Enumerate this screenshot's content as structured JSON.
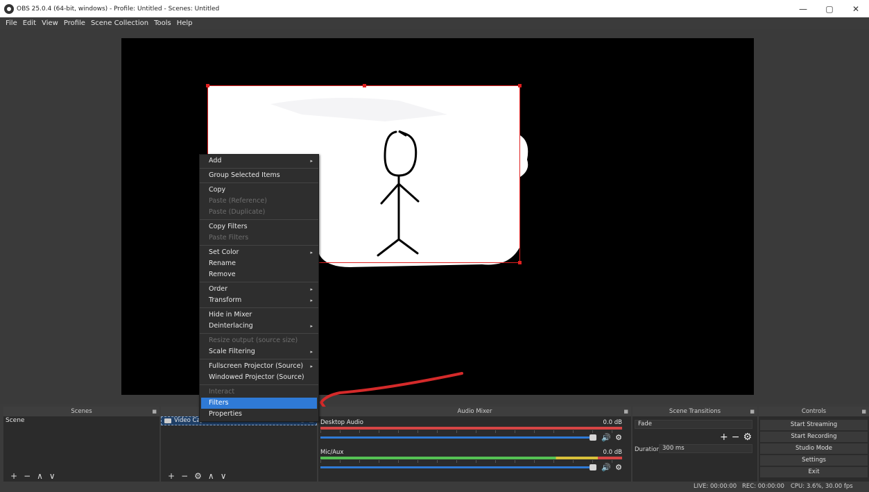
{
  "window": {
    "title": "OBS 25.0.4 (64-bit, windows) - Profile: Untitled - Scenes: Untitled",
    "minimize": "—",
    "maximize": "▢",
    "close": "✕"
  },
  "menubar": [
    "File",
    "Edit",
    "View",
    "Profile",
    "Scene Collection",
    "Tools",
    "Help"
  ],
  "context_menu": {
    "items": [
      {
        "label": "Add",
        "submenu": true
      },
      {
        "separator": true
      },
      {
        "label": "Group Selected Items"
      },
      {
        "separator": true
      },
      {
        "label": "Copy"
      },
      {
        "label": "Paste (Reference)",
        "disabled": true
      },
      {
        "label": "Paste (Duplicate)",
        "disabled": true
      },
      {
        "separator": true
      },
      {
        "label": "Copy Filters"
      },
      {
        "label": "Paste Filters",
        "disabled": true
      },
      {
        "separator": true
      },
      {
        "label": "Set Color",
        "submenu": true
      },
      {
        "label": "Rename"
      },
      {
        "label": "Remove"
      },
      {
        "separator": true
      },
      {
        "label": "Order",
        "submenu": true
      },
      {
        "label": "Transform",
        "submenu": true
      },
      {
        "separator": true
      },
      {
        "label": "Hide in Mixer"
      },
      {
        "label": "Deinterlacing",
        "submenu": true
      },
      {
        "separator": true
      },
      {
        "label": "Resize output (source size)",
        "disabled": true
      },
      {
        "label": "Scale Filtering",
        "submenu": true
      },
      {
        "separator": true
      },
      {
        "label": "Fullscreen Projector (Source)",
        "submenu": true
      },
      {
        "label": "Windowed Projector (Source)"
      },
      {
        "separator": true
      },
      {
        "label": "Interact",
        "disabled": true
      },
      {
        "label": "Filters",
        "highlighted": true
      },
      {
        "label": "Properties"
      }
    ]
  },
  "docks": {
    "scenes": {
      "title": "Scenes",
      "items": [
        "Scene"
      ]
    },
    "sources": {
      "items": [
        "Video Capture Device"
      ]
    },
    "audio_mixer": {
      "title": "Audio Mixer",
      "channels": [
        {
          "name": "Desktop Audio",
          "db": "0.0 dB",
          "level_color": "#d64545"
        },
        {
          "name": "Mic/Aux",
          "db": "0.0 dB",
          "level_color": "#55c254"
        }
      ]
    },
    "transitions": {
      "title": "Scene Transitions",
      "selected": "Fade",
      "duration_label": "Duration",
      "duration_value": "300 ms"
    },
    "controls": {
      "title": "Controls",
      "buttons": [
        "Start Streaming",
        "Start Recording",
        "Studio Mode",
        "Settings",
        "Exit"
      ]
    }
  },
  "statusbar": {
    "live": "LIVE: 00:00:00",
    "rec": "REC: 00:00:00",
    "cpu": "CPU: 3.6%, 30.00 fps"
  },
  "colors": {
    "accent": "#2f7ad6",
    "selection_border": "#e02020",
    "annotation_arrow": "#d42a2a"
  }
}
